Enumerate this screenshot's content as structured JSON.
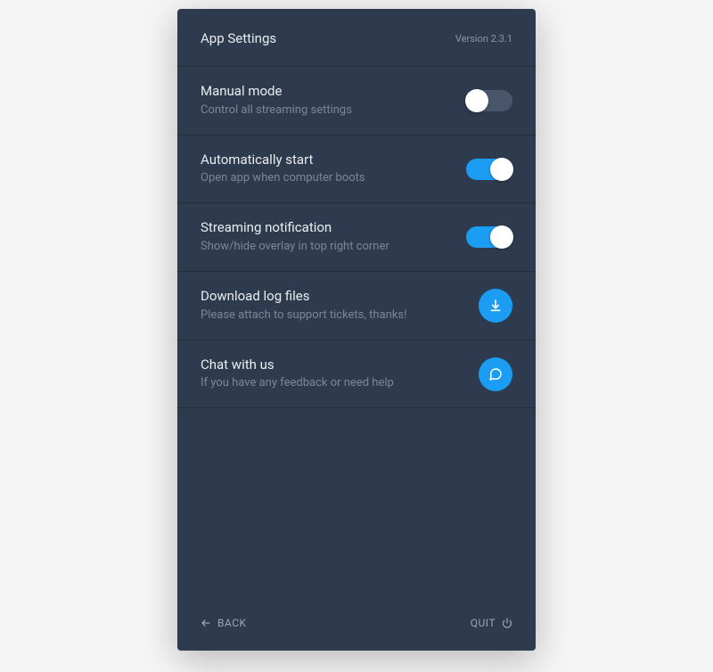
{
  "header": {
    "title": "App Settings",
    "version": "Version 2.3.1"
  },
  "rows": [
    {
      "id": "manual-mode",
      "title": "Manual mode",
      "sub": "Control all streaming settings",
      "type": "toggle",
      "value": false
    },
    {
      "id": "auto-start",
      "title": "Automatically start",
      "sub": "Open app when computer boots",
      "type": "toggle",
      "value": true
    },
    {
      "id": "stream-notification",
      "title": "Streaming notification",
      "sub": "Show/hide overlay in top right corner",
      "type": "toggle",
      "value": true
    },
    {
      "id": "download-logs",
      "title": "Download log files",
      "sub": "Please attach to support tickets, thanks!",
      "type": "action",
      "icon": "download-icon"
    },
    {
      "id": "chat",
      "title": "Chat with us",
      "sub": "If you have any feedback or need help",
      "type": "action",
      "icon": "chat-icon"
    }
  ],
  "footer": {
    "back": "BACK",
    "quit": "QUIT"
  },
  "colors": {
    "accent": "#1b9df3",
    "panel_bg": "#2e3b4e",
    "divider": "#222c3b",
    "text_primary": "#e8ecef",
    "text_secondary": "#7a8699"
  }
}
